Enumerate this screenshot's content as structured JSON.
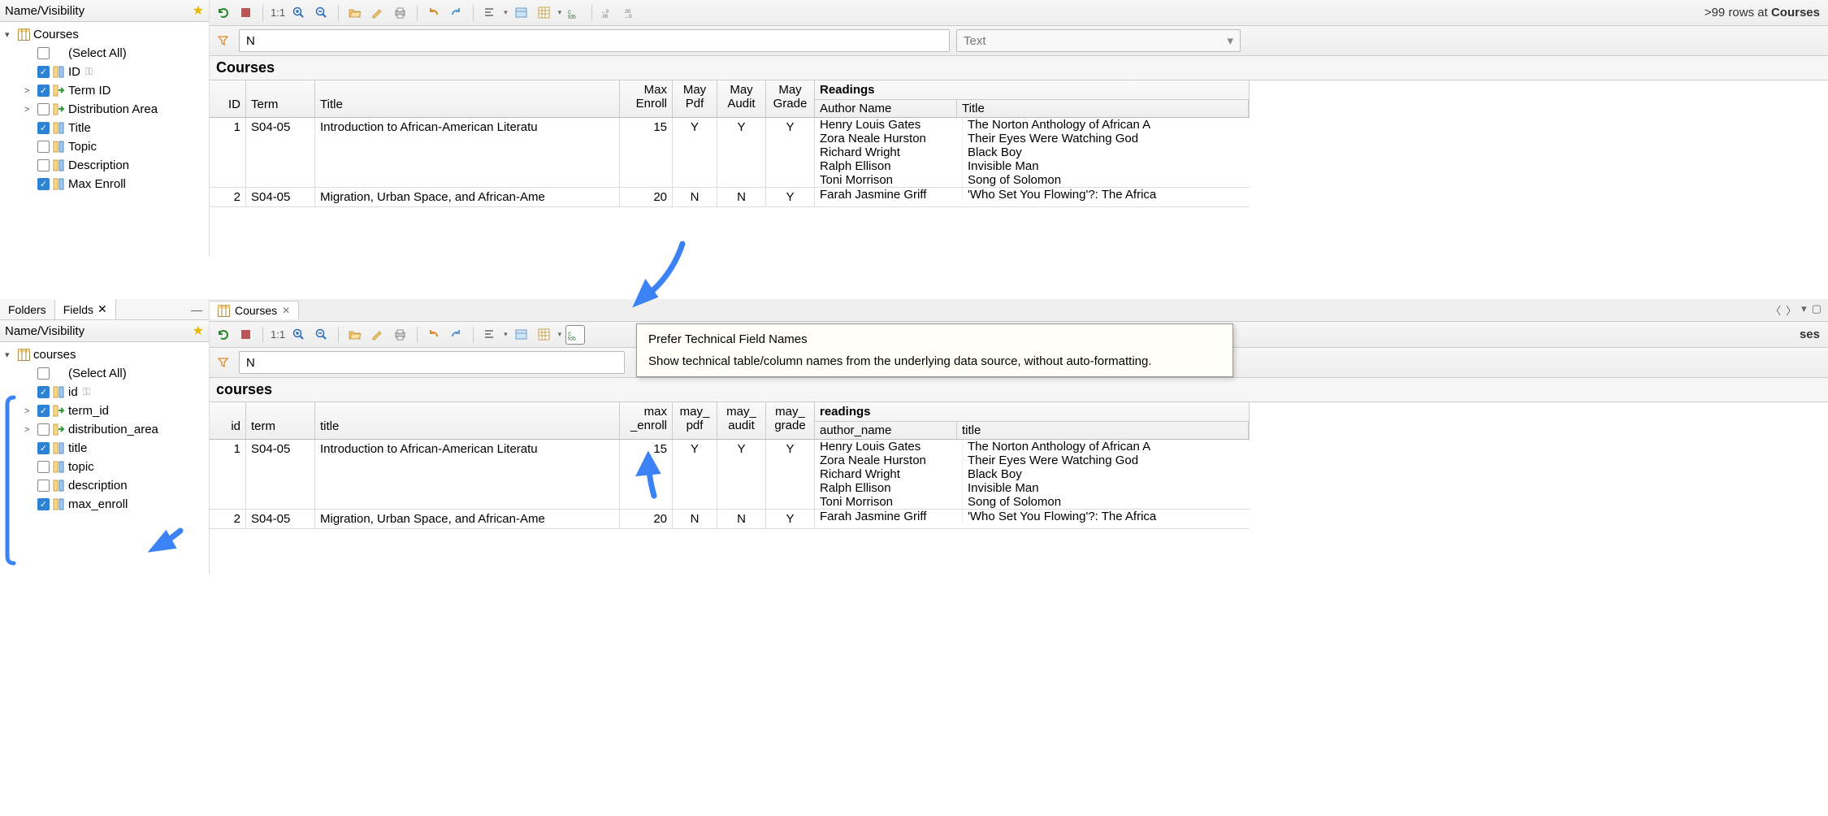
{
  "panel1": {
    "sidebar": {
      "header": "Name/Visibility",
      "root": "Courses",
      "items": [
        {
          "label": "(Select All)",
          "checked": false,
          "icon": "none",
          "twisty": ""
        },
        {
          "label": "ID",
          "checked": true,
          "icon": "column",
          "key": true,
          "twisty": ""
        },
        {
          "label": "Term ID",
          "checked": true,
          "icon": "fk",
          "twisty": ">"
        },
        {
          "label": "Distribution Area",
          "checked": false,
          "icon": "fk",
          "twisty": ">"
        },
        {
          "label": "Title",
          "checked": true,
          "icon": "column",
          "twisty": ""
        },
        {
          "label": "Topic",
          "checked": false,
          "icon": "column",
          "twisty": ""
        },
        {
          "label": "Description",
          "checked": false,
          "icon": "column",
          "twisty": ""
        },
        {
          "label": "Max Enroll",
          "checked": true,
          "icon": "column",
          "twisty": ""
        }
      ]
    },
    "toolbar": {
      "status_prefix": ">99 rows at ",
      "status_table": "Courses",
      "oneToOne": "1:1"
    },
    "filter": {
      "value": "N",
      "type_placeholder": "Text"
    },
    "grid": {
      "title": "Courses",
      "headers": {
        "id": "ID",
        "term": "Term",
        "title": "Title",
        "maxEnroll": {
          "l1": "Max",
          "l2": "Enroll"
        },
        "mayPdf": {
          "l1": "May",
          "l2": "Pdf"
        },
        "mayAudit": {
          "l1": "May",
          "l2": "Audit"
        },
        "mayGrade": {
          "l1": "May",
          "l2": "Grade"
        },
        "readings": "Readings",
        "authorName": "Author Name",
        "rtitle": "Title"
      },
      "rows": [
        {
          "id": "1",
          "term": "S04-05",
          "title": "Introduction to African-American Literatu",
          "max": "15",
          "pdf": "Y",
          "audit": "Y",
          "grade": "Y",
          "readings": [
            {
              "author": "Henry Louis Gates",
              "title": "The Norton Anthology of African A"
            },
            {
              "author": "Zora Neale Hurston",
              "title": "Their Eyes Were Watching God"
            },
            {
              "author": "Richard Wright",
              "title": "Black Boy"
            },
            {
              "author": "Ralph Ellison",
              "title": "Invisible Man"
            },
            {
              "author": "Toni Morrison",
              "title": "Song of Solomon"
            }
          ]
        },
        {
          "id": "2",
          "term": "S04-05",
          "title": "Migration, Urban Space, and African-Ame",
          "max": "20",
          "pdf": "N",
          "audit": "N",
          "grade": "Y",
          "readings": [
            {
              "author": "Farah Jasmine Griff",
              "title": "'Who Set You Flowing'?: The Africa"
            }
          ]
        }
      ]
    }
  },
  "panel2": {
    "sidebar": {
      "tabs": {
        "folders": "Folders",
        "fields": "Fields"
      },
      "header": "Name/Visibility",
      "root": "courses",
      "items": [
        {
          "label": "(Select All)",
          "checked": false,
          "icon": "none",
          "twisty": ""
        },
        {
          "label": "id",
          "checked": true,
          "icon": "column",
          "key": true,
          "twisty": ""
        },
        {
          "label": "term_id",
          "checked": true,
          "icon": "fk",
          "twisty": ">"
        },
        {
          "label": "distribution_area",
          "checked": false,
          "icon": "fk",
          "twisty": ">"
        },
        {
          "label": "title",
          "checked": true,
          "icon": "column",
          "twisty": ""
        },
        {
          "label": "topic",
          "checked": false,
          "icon": "column",
          "twisty": ""
        },
        {
          "label": "description",
          "checked": false,
          "icon": "column",
          "twisty": ""
        },
        {
          "label": "max_enroll",
          "checked": true,
          "icon": "column",
          "twisty": ""
        }
      ]
    },
    "tabs": {
      "courses": "Courses"
    },
    "toolbar": {
      "oneToOne": "1:1",
      "status_suffix": "ses"
    },
    "filter": {
      "value": "N"
    },
    "tooltip": {
      "title": "Prefer Technical Field Names",
      "body": "Show technical table/column names from the underlying data source, without auto-formatting."
    },
    "grid": {
      "title": "courses",
      "headers": {
        "id": "id",
        "term": "term",
        "title": "title",
        "maxEnroll": {
          "l1": "max",
          "l2": "_enroll"
        },
        "mayPdf": {
          "l1": "may_",
          "l2": "pdf"
        },
        "mayAudit": {
          "l1": "may_",
          "l2": "audit"
        },
        "mayGrade": {
          "l1": "may_",
          "l2": "grade"
        },
        "readings": "readings",
        "authorName": "author_name",
        "rtitle": "title"
      },
      "rows": [
        {
          "id": "1",
          "term": "S04-05",
          "title": "Introduction to African-American Literatu",
          "max": "15",
          "pdf": "Y",
          "audit": "Y",
          "grade": "Y",
          "readings": [
            {
              "author": "Henry Louis Gates",
              "title": "The Norton Anthology of African A"
            },
            {
              "author": "Zora Neale Hurston",
              "title": "Their Eyes Were Watching God"
            },
            {
              "author": "Richard Wright",
              "title": "Black Boy"
            },
            {
              "author": "Ralph Ellison",
              "title": "Invisible Man"
            },
            {
              "author": "Toni Morrison",
              "title": "Song of Solomon"
            }
          ]
        },
        {
          "id": "2",
          "term": "S04-05",
          "title": "Migration, Urban Space, and African-Ame",
          "max": "20",
          "pdf": "N",
          "audit": "N",
          "grade": "Y",
          "readings": [
            {
              "author": "Farah Jasmine Griff",
              "title": "'Who Set You Flowing'?: The Africa"
            }
          ]
        }
      ]
    }
  }
}
